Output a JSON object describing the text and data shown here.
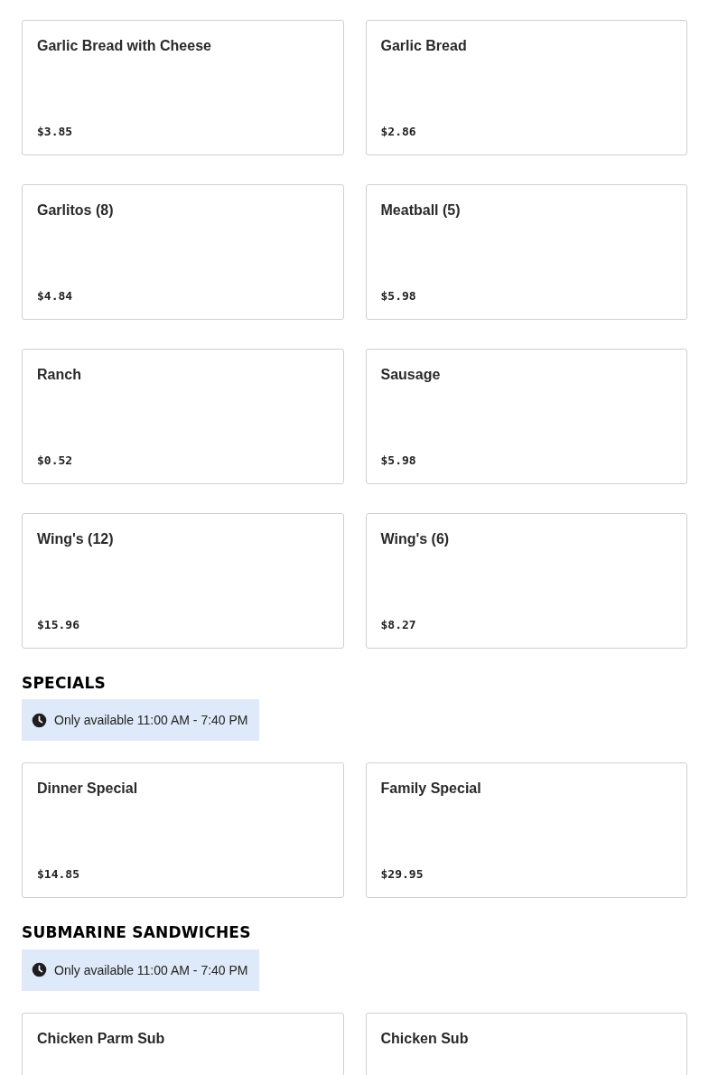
{
  "sections": [
    {
      "items": [
        {
          "name": "Garlic Bread with Cheese",
          "price": "$3.85"
        },
        {
          "name": "Garlic Bread",
          "price": "$2.86"
        },
        {
          "name": "Garlitos (8)",
          "price": "$4.84"
        },
        {
          "name": "Meatball (5)",
          "price": "$5.98"
        },
        {
          "name": "Ranch",
          "price": "$0.52"
        },
        {
          "name": "Sausage",
          "price": "$5.98"
        },
        {
          "name": "Wing's (12)",
          "price": "$15.96"
        },
        {
          "name": "Wing's (6)",
          "price": "$8.27"
        }
      ]
    },
    {
      "title": "SPECIALS",
      "availability": "Only available 11:00 AM - 7:40 PM",
      "items": [
        {
          "name": "Dinner Special",
          "price": "$14.85"
        },
        {
          "name": "Family Special",
          "price": "$29.95"
        }
      ]
    },
    {
      "title": "SUBMARINE SANDWICHES",
      "availability": "Only available 11:00 AM - 7:40 PM",
      "items": [
        {
          "name": "Chicken Parm Sub"
        },
        {
          "name": "Chicken Sub"
        }
      ]
    }
  ]
}
